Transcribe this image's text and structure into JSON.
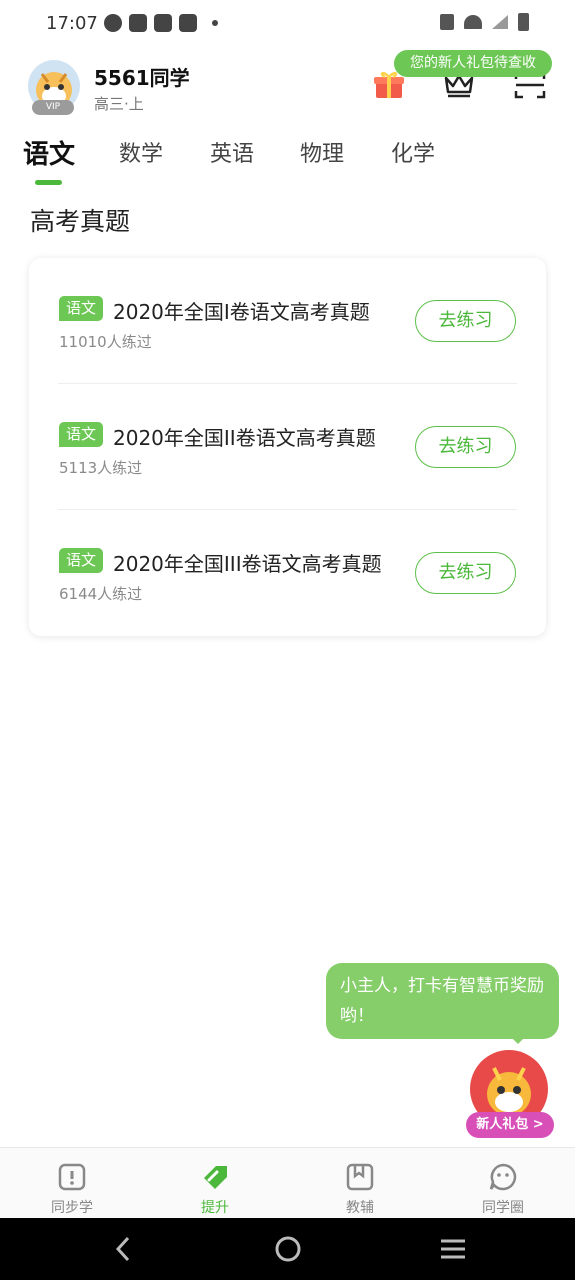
{
  "status_bar": {
    "time": "17:07"
  },
  "header": {
    "username": "5561同学",
    "grade": "高三·上",
    "vip_label": "VIP",
    "gift_tip": "您的新人礼包待查收"
  },
  "tabs": [
    {
      "label": "语文",
      "active": true
    },
    {
      "label": "数学",
      "active": false
    },
    {
      "label": "英语",
      "active": false
    },
    {
      "label": "物理",
      "active": false
    },
    {
      "label": "化学",
      "active": false
    }
  ],
  "section_title": "高考真题",
  "exams": [
    {
      "tag": "语文",
      "title": "2020年全国I卷语文高考真题",
      "practiced": "11010人练过",
      "button": "去练习"
    },
    {
      "tag": "语文",
      "title": "2020年全国II卷语文高考真题",
      "practiced": "5113人练过",
      "button": "去练习"
    },
    {
      "tag": "语文",
      "title": "2020年全国III卷语文高考真题",
      "practiced": "6144人练过",
      "button": "去练习"
    }
  ],
  "floating": {
    "bubble_text": "小主人，打卡有智慧币奖励哟！",
    "badge": "新人礼包 >"
  },
  "bottom_nav": [
    {
      "label": "同步学",
      "icon": "book-icon",
      "active": false
    },
    {
      "label": "提升",
      "icon": "tag-icon",
      "active": true
    },
    {
      "label": "教辅",
      "icon": "bookmark-book-icon",
      "active": false
    },
    {
      "label": "同学圈",
      "icon": "chat-face-icon",
      "active": false
    }
  ],
  "colors": {
    "accent": "#4cb83b",
    "tag_green": "#6dc755",
    "bubble_green": "#86ce6a",
    "badge_pink": "#d84fb8"
  }
}
